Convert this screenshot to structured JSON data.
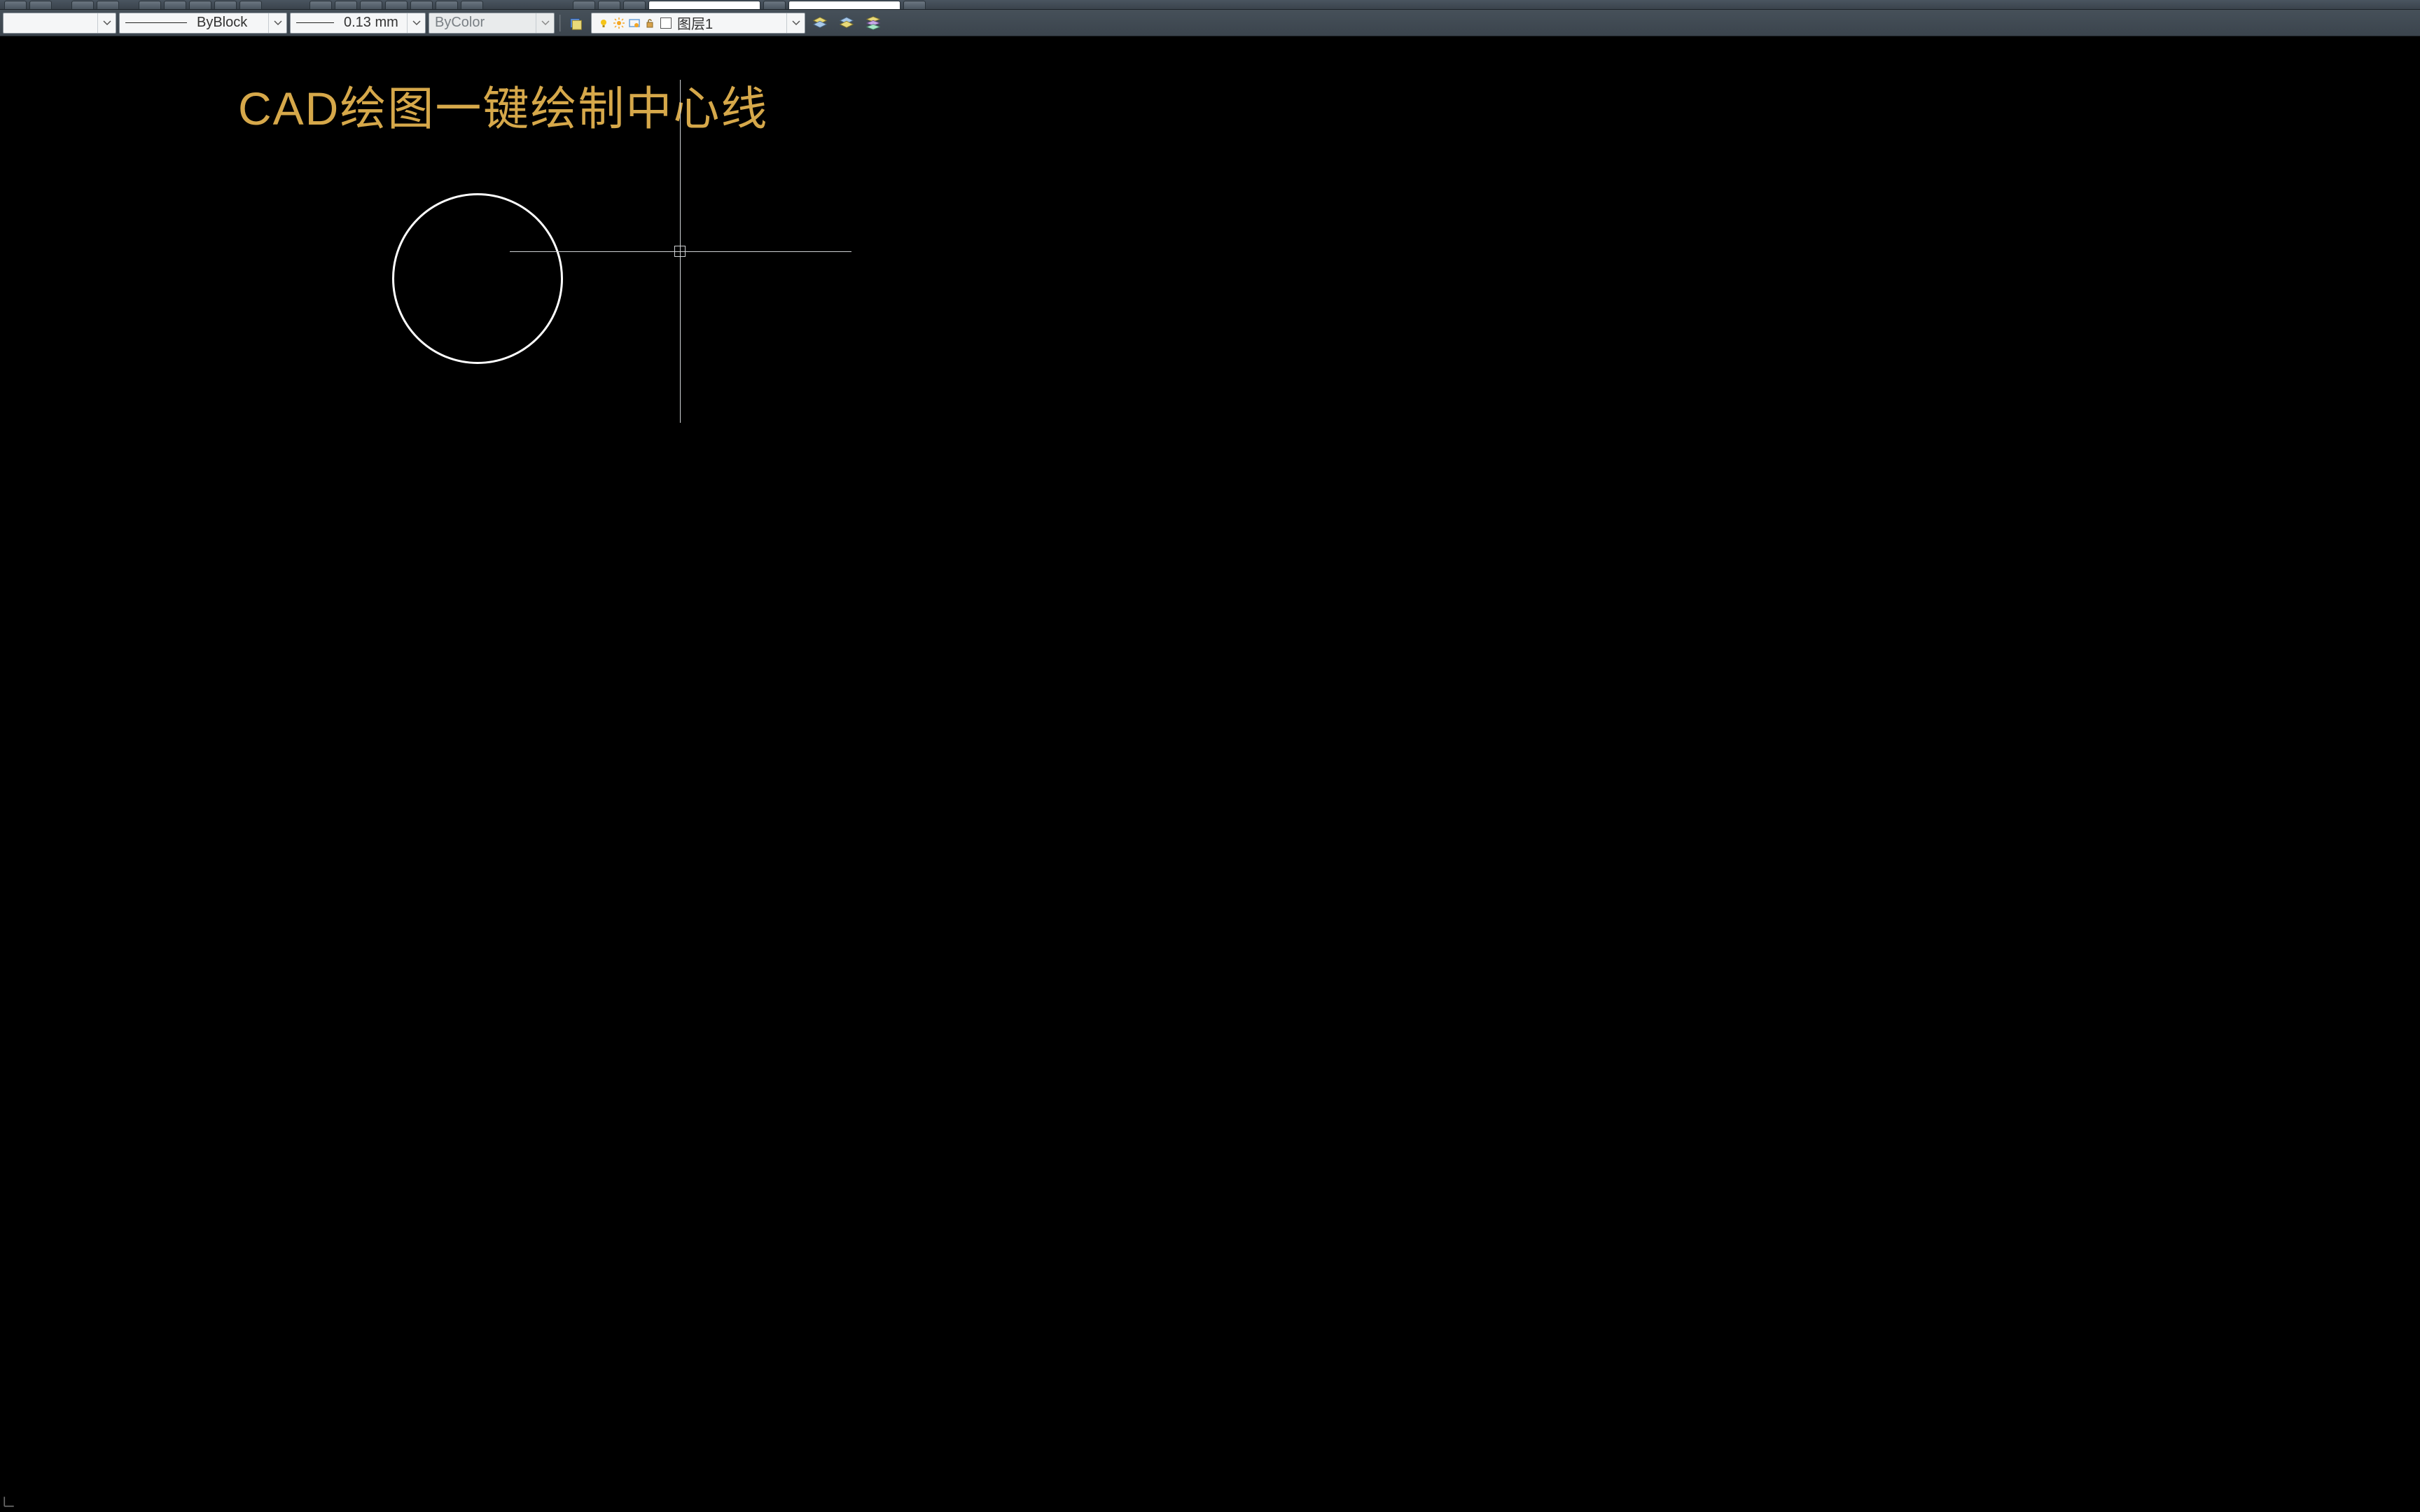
{
  "toolbar": {
    "color_selector": {
      "value": ""
    },
    "linetype_selector": {
      "value": "ByBlock"
    },
    "lineweight_selector": {
      "value": "0.13 mm"
    },
    "plotstyle_selector": {
      "value": "ByColor"
    },
    "layer_selector": {
      "value": "图层1"
    }
  },
  "canvas": {
    "title": "CAD绘图一键绘制中心线"
  },
  "icons": {
    "chevron_down": "chevron-down",
    "layer_props": "layer-properties",
    "layer_states": "layer-states",
    "layer_stack1": "layer-stack-1",
    "layer_stack2": "layer-stack-2",
    "layer_stack3": "layer-stack-3",
    "bulb": "lightbulb-on",
    "sun": "sun",
    "freeze_vp": "viewport-freeze",
    "lock": "lock-open",
    "swatch": "color-swatch"
  }
}
